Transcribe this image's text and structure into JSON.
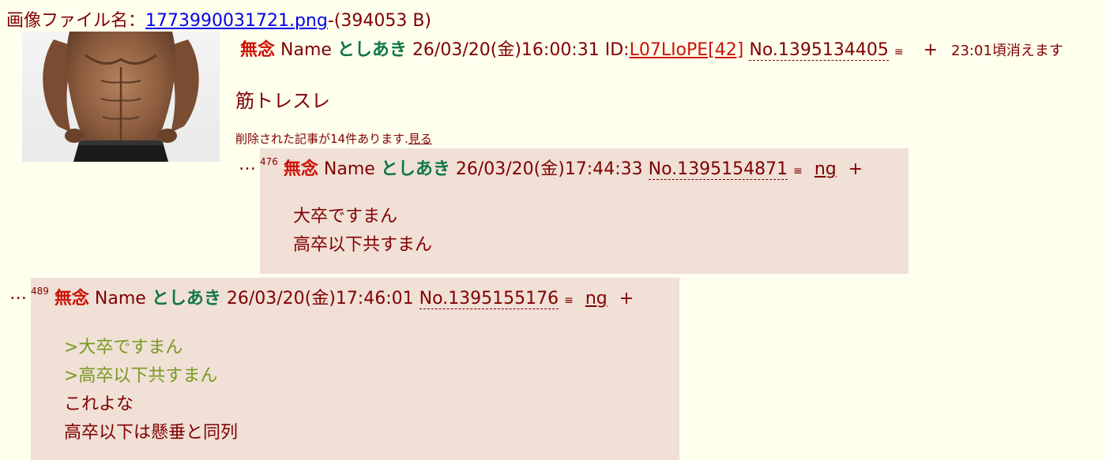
{
  "file": {
    "label": "画像ファイル名：",
    "filename": "1773990031721.png",
    "size": "-(394053 B)"
  },
  "op": {
    "subject": "無念",
    "name_label": "Name",
    "name": "としあき",
    "date": "26/03/20(金)16:00:31",
    "id_label": "ID:",
    "id_value": "L07LIoPE[42]",
    "number": "No.1395134405",
    "menu": "≡",
    "plus": "+",
    "expire": "23:01頃消えます",
    "body": "筋トレスレ",
    "deleted_text": "削除された記事が14件あります.",
    "deleted_link": "見る"
  },
  "replies": [
    {
      "ellipsis": "…",
      "rsc": "476",
      "subject": "無念",
      "name_label": "Name",
      "name": "としあき",
      "date": "26/03/20(金)17:44:33",
      "number": "No.1395154871",
      "menu": "≡",
      "ng": "ng",
      "plus": "+",
      "lines": [
        {
          "text": "大卒ですまん",
          "quote": false
        },
        {
          "text": "高卒以下共すまん",
          "quote": false
        }
      ]
    },
    {
      "ellipsis": "…",
      "rsc": "489",
      "subject": "無念",
      "name_label": "Name",
      "name": "としあき",
      "date": "26/03/20(金)17:46:01",
      "number": "No.1395155176",
      "menu": "≡",
      "ng": "ng",
      "plus": "+",
      "lines": [
        {
          "text": ">大卒ですまん",
          "quote": true
        },
        {
          "text": ">高卒以下共すまん",
          "quote": true
        },
        {
          "text": "これよな",
          "quote": false
        },
        {
          "text": "高卒以下は懸垂と同列",
          "quote": false
        }
      ]
    }
  ]
}
